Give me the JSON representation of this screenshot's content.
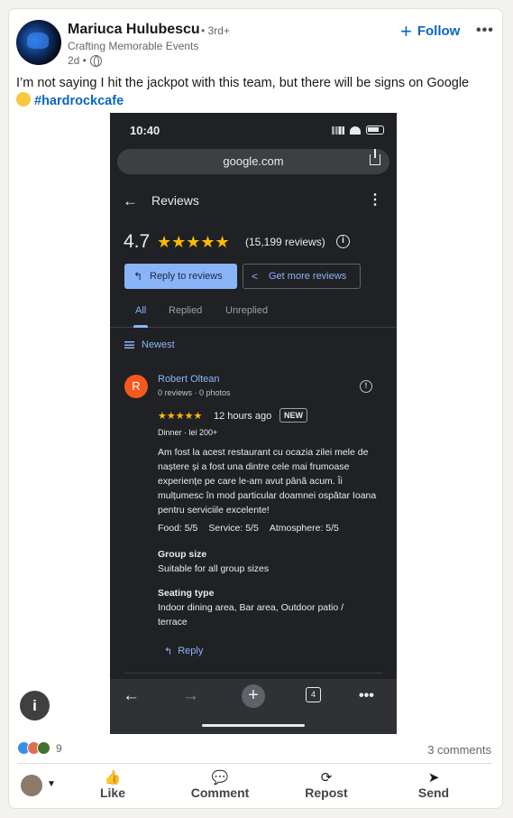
{
  "post": {
    "author": "Mariuca Hulubescu",
    "degree": "• 3rd+",
    "headline": "Crafting Memorable Events",
    "time": "2d •",
    "follow_label": "Follow",
    "more_label": "•••",
    "text": "I’m not saying I hit the jackpot with this team, but there will be signs on Google",
    "hashtag": "#hardrockcafe"
  },
  "phone": {
    "status_time": "10:40",
    "url": "google.com",
    "page_title": "Reviews",
    "rating": "4.7",
    "stars": "★★★★★",
    "review_count": "(15,199 reviews)",
    "reply_button": "Reply to reviews",
    "more_reviews_button": "Get more reviews",
    "tabs": [
      "All",
      "Replied",
      "Unreplied"
    ],
    "sort_label": "Newest",
    "review": {
      "avatar_letter": "R",
      "name": "Robert Oltean",
      "sub": "0 reviews · 0 photos",
      "stars": "★★★★★",
      "time": "12 hours ago",
      "badge": "NEW",
      "meal": "Dinner · lei 200+",
      "body": "Am fost la acest restaurant cu ocazia zilei mele de naștere și a fost una dintre cele mai frumoase experiențe pe care le-am avut până acum. Îi mulțumesc în mod particular doamnei ospătar Ioana pentru serviciile excelente!",
      "food": "Food: 5/5",
      "service": "Service: 5/5",
      "atmosphere": "Atmosphere: 5/5",
      "group_size_label": "Group size",
      "group_size_value": "Suitable for all group sizes",
      "seating_label": "Seating type",
      "seating_value": "Indoor dining area, Bar area, Outdoor patio / terrace",
      "reply_label": "Reply"
    },
    "tab_count": "4"
  },
  "social": {
    "reaction_count": "9",
    "comments": "3 comments",
    "actions": [
      "Like",
      "Comment",
      "Repost",
      "Send"
    ]
  },
  "colors": {
    "link_blue": "#0a66c2",
    "google_dark_bg": "#202124",
    "google_blue": "#8ab4f8",
    "star_yellow": "#fbbc04"
  }
}
